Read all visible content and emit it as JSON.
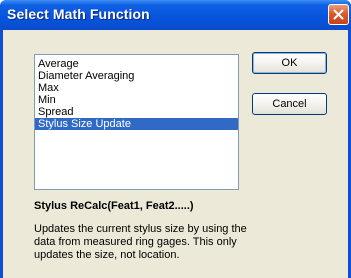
{
  "window": {
    "title": "Select Math Function",
    "close_icon": "close-icon"
  },
  "functions": {
    "items": [
      {
        "label": "Average",
        "selected": false
      },
      {
        "label": "Diameter Averaging",
        "selected": false
      },
      {
        "label": "Max",
        "selected": false
      },
      {
        "label": "Min",
        "selected": false
      },
      {
        "label": "Spread",
        "selected": false
      },
      {
        "label": "Stylus Size Update",
        "selected": true
      }
    ]
  },
  "buttons": {
    "ok_label": "OK",
    "cancel_label": "Cancel"
  },
  "detail": {
    "syntax": "Stylus ReCalc(Feat1, Feat2.....)",
    "description": "Updates the current stylus size by using the data from measured ring gages. This only updates the size, not location."
  },
  "colors": {
    "titlebar": "#0654dd",
    "selection": "#316ac5",
    "close_button": "#d95b2c",
    "dialog_face": "#ece9d8"
  }
}
